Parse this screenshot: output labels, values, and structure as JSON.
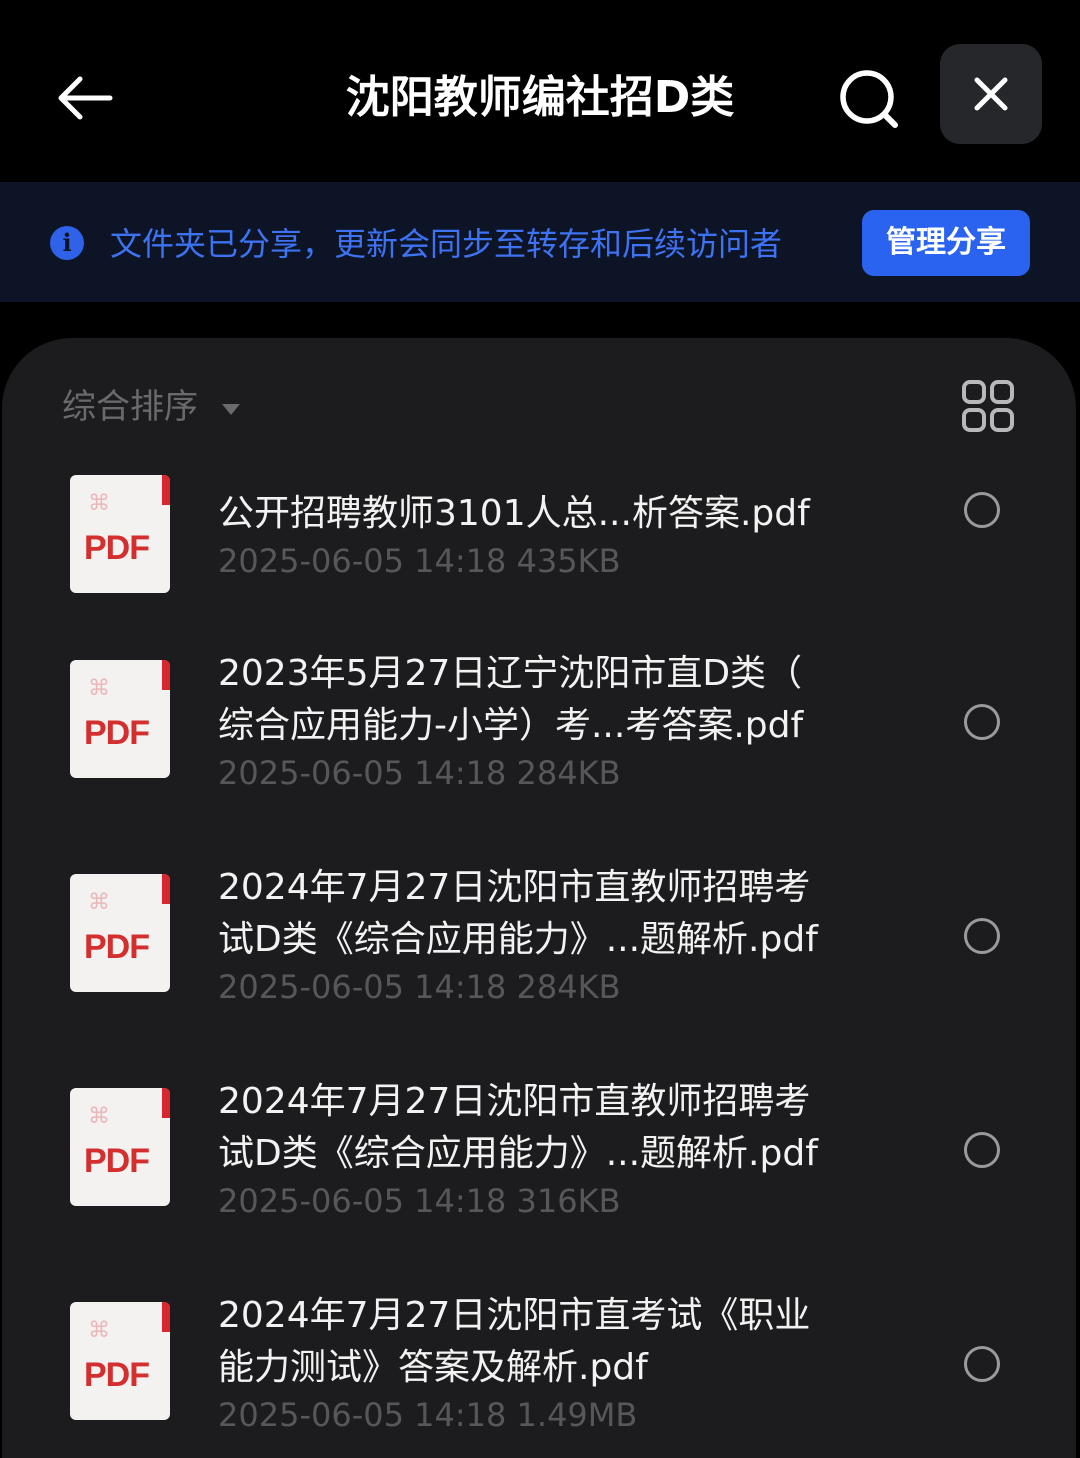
{
  "header": {
    "title": "沈阳教师编社招D类",
    "back_icon": "arrow-left-icon",
    "search_icon": "search-icon",
    "close_icon": "close-icon"
  },
  "share_banner": {
    "info_icon": "info-icon",
    "message": "文件夹已分享，更新会同步至转存和后续访问者",
    "manage_button": "管理分享"
  },
  "toolbar": {
    "sort_label": "综合排序",
    "grid_icon": "grid-view-icon"
  },
  "files": [
    {
      "name_line1": "",
      "name_line2": "公开招聘教师3101人总...析答案.pdf",
      "meta": "2025-06-05 14:18  435KB",
      "type": "PDF"
    },
    {
      "name_line1": "2023年5月27日辽宁沈阳市直D类（",
      "name_line2": "综合应用能力-小学）考...考答案.pdf",
      "meta": "2025-06-05 14:18  284KB",
      "type": "PDF"
    },
    {
      "name_line1": "2024年7月27日沈阳市直教师招聘考",
      "name_line2": "试D类《综合应用能力》...题解析.pdf",
      "meta": "2025-06-05 14:18  284KB",
      "type": "PDF"
    },
    {
      "name_line1": "2024年7月27日沈阳市直教师招聘考",
      "name_line2": "试D类《综合应用能力》...题解析.pdf",
      "meta": "2025-06-05 14:18  316KB",
      "type": "PDF"
    },
    {
      "name_line1": "2024年7月27日沈阳市直考试《职业",
      "name_line2": "能力测试》答案及解析.pdf",
      "meta": "2025-06-05 14:18  1.49MB",
      "type": "PDF"
    }
  ],
  "colors": {
    "background": "#000000",
    "panel": "#1c1c1e",
    "accent_blue": "#2a63f0",
    "banner_text": "#3d72f2",
    "pdf_red": "#d32f2f"
  }
}
